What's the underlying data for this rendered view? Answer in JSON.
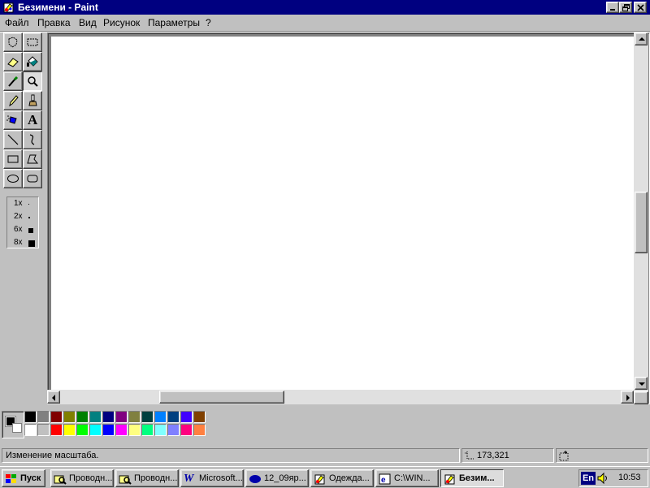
{
  "window": {
    "title": "Безимени - Paint"
  },
  "menu": [
    "Файл",
    "Правка",
    "Вид",
    "Рисунок",
    "Параметры",
    "?"
  ],
  "toolbox": {
    "tools": [
      {
        "name": "free-select-icon"
      },
      {
        "name": "rect-select-icon"
      },
      {
        "name": "eraser-icon"
      },
      {
        "name": "fill-icon"
      },
      {
        "name": "color-picker-icon"
      },
      {
        "name": "magnifier-icon"
      },
      {
        "name": "pencil-icon"
      },
      {
        "name": "brush-icon"
      },
      {
        "name": "airbrush-icon"
      },
      {
        "name": "text-icon",
        "glyph": "A"
      },
      {
        "name": "line-icon"
      },
      {
        "name": "curve-icon"
      },
      {
        "name": "rectangle-icon"
      },
      {
        "name": "polygon-icon"
      },
      {
        "name": "ellipse-icon"
      },
      {
        "name": "rounded-rect-icon"
      }
    ],
    "zoom_options": [
      "1x",
      "2x",
      "6x",
      "8x"
    ]
  },
  "palette": {
    "foreground": "#000000",
    "background": "#ffffff",
    "row1": [
      "#000000",
      "#808080",
      "#800000",
      "#808000",
      "#008000",
      "#008080",
      "#000080",
      "#800080",
      "#808040",
      "#004040",
      "#0080ff",
      "#004080",
      "#4000ff",
      "#804000"
    ],
    "row2": [
      "#ffffff",
      "#c0c0c0",
      "#ff0000",
      "#ffff00",
      "#00ff00",
      "#00ffff",
      "#0000ff",
      "#ff00ff",
      "#ffff80",
      "#00ff80",
      "#80ffff",
      "#8080ff",
      "#ff0080",
      "#ff8040"
    ]
  },
  "status": {
    "message": "Изменение масштаба.",
    "coords": "173,321"
  },
  "taskbar": {
    "start": "Пуск",
    "buttons": [
      "Проводн...",
      "Проводн...",
      "Microsoft...",
      "12_09яр...",
      "Одежда...",
      "C:\\WIN...",
      "Безим..."
    ],
    "lang": "En",
    "clock": "10:53"
  }
}
